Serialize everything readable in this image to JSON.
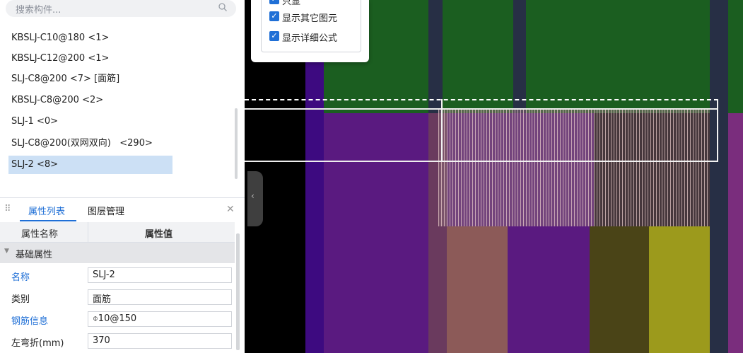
{
  "search": {
    "placeholder": "搜索构件..."
  },
  "components": [
    "KBSLJ-C10@180 <1>",
    "KBSLJ-C12@200 <1>",
    "SLJ-C8@200 <7> [面筋]",
    "KBSLJ-C8@200 <2>",
    "SLJ-1 <0>",
    "SLJ-C8@200(双网双向)   <290>",
    "SLJ-2 <8>"
  ],
  "selected_component": "SLJ-2 <8>",
  "tabs": {
    "attr": "属性列表",
    "layer": "图层管理"
  },
  "table": {
    "col_name": "属性名称",
    "col_value": "属性值",
    "group": "基础属性"
  },
  "props": [
    {
      "name": "名称",
      "value": "SLJ-2",
      "blue": true
    },
    {
      "name": "类别",
      "value": "面筋",
      "blue": false
    },
    {
      "name": "钢筋信息",
      "value": "⌽10@150",
      "blue": true
    },
    {
      "name": "左弯折(mm)",
      "value": "370",
      "blue": false
    }
  ],
  "options": [
    {
      "label": "只显",
      "checked": true
    },
    {
      "label": "显示其它图元",
      "checked": true
    },
    {
      "label": "显示详细公式",
      "checked": true
    }
  ],
  "icons": [
    "search-icon",
    "grip-icon",
    "close-icon",
    "collapse-arrow-icon",
    "checkbox-icon"
  ],
  "colors": {
    "accent": "#1f6fd6",
    "green": "#1b5e20",
    "purple": "#5a1a80",
    "olive": "#9c9a1c",
    "pink": "#8c5a58"
  }
}
